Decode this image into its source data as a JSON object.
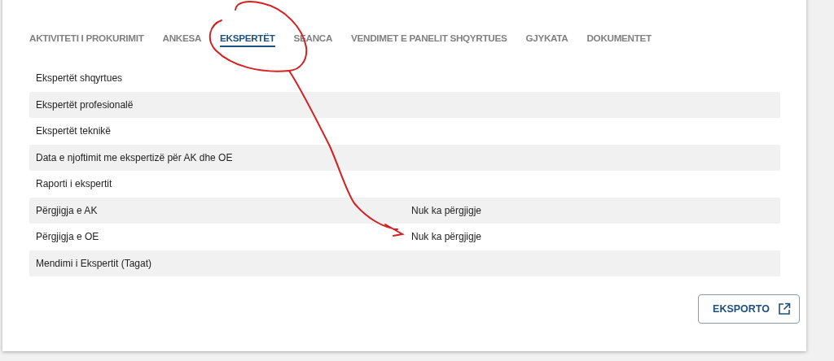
{
  "tabs": [
    {
      "label": "AKTIVITETI I PROKURIMIT",
      "selected": false
    },
    {
      "label": "ANKESA",
      "selected": false
    },
    {
      "label": "EKSPERTËT",
      "selected": true
    },
    {
      "label": "SEANCA",
      "selected": false
    },
    {
      "label": "VENDIMET E PANELIT SHQYRTUES",
      "selected": false
    },
    {
      "label": "GJYKATA",
      "selected": false
    },
    {
      "label": "DOKUMENTET",
      "selected": false
    }
  ],
  "rows": [
    {
      "label": "Ekspertët shqyrtues"
    },
    {
      "label": "Ekspertët profesionalë"
    },
    {
      "label": "Ekspertët teknikë"
    },
    {
      "label": "Data e njoftimit me ekspertizë për AK dhe OE"
    },
    {
      "label": "Raporti i ekspertit"
    },
    {
      "label": "Përgjigja e AK",
      "value": "Nuk ka përgjigje"
    },
    {
      "label": "Përgjigja e OE",
      "value": "Nuk ka përgjigje"
    },
    {
      "label": "Mendimi i Ekspertit (Tagat)"
    }
  ],
  "export_button": {
    "label": "EKSPORTO"
  }
}
